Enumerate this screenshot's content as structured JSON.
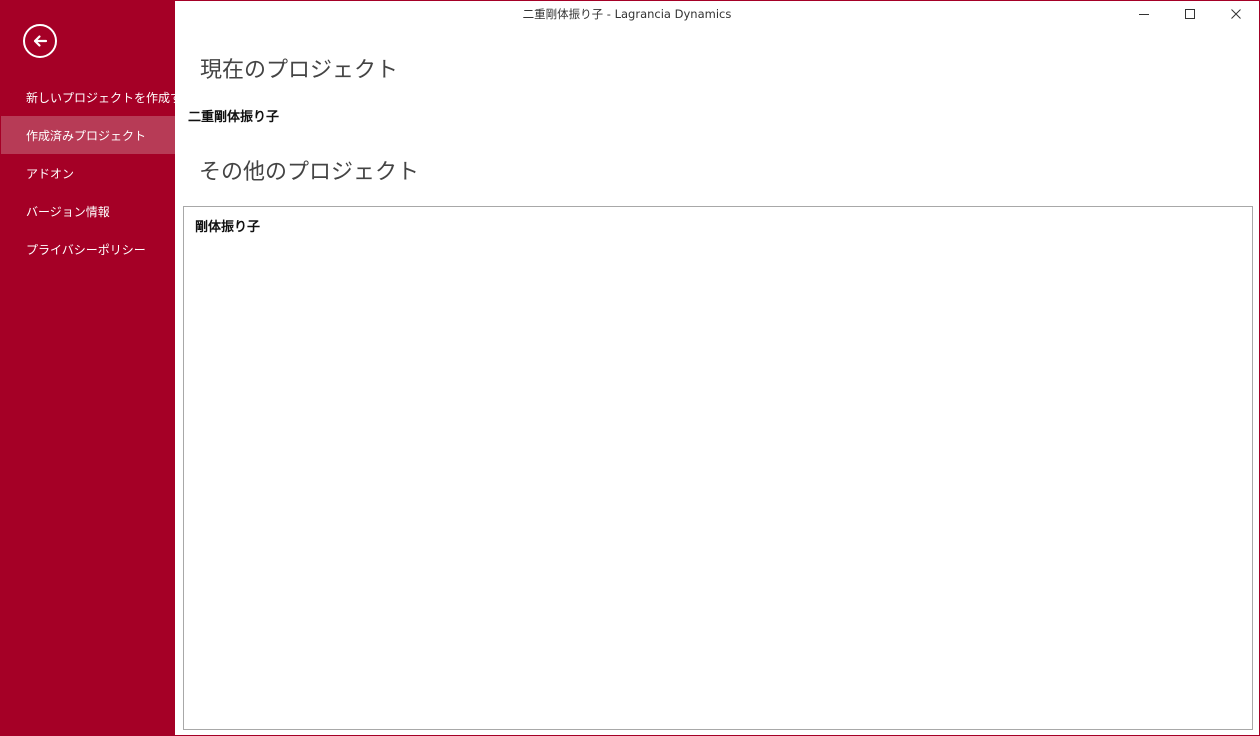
{
  "window": {
    "title": "二重剛体振り子 - Lagrancia Dynamics",
    "accent_color": "#a50026",
    "selected_color": "#b73b56"
  },
  "sidebar": {
    "back_icon": "arrow-left-circle-icon",
    "items": [
      {
        "label": "新しいプロジェクトを作成する",
        "selected": false
      },
      {
        "label": "作成済みプロジェクト",
        "selected": true
      },
      {
        "label": "アドオン",
        "selected": false
      },
      {
        "label": "バージョン情報",
        "selected": false
      },
      {
        "label": "プライバシーポリシー",
        "selected": false
      }
    ]
  },
  "window_controls": {
    "minimize_icon": "minimize-icon",
    "maximize_icon": "maximize-icon",
    "close_icon": "close-icon"
  },
  "main": {
    "current_heading": "現在のプロジェクト",
    "current_project": "二重剛体振り子",
    "others_heading": "その他のプロジェクト",
    "other_projects": [
      "剛体振り子"
    ]
  }
}
